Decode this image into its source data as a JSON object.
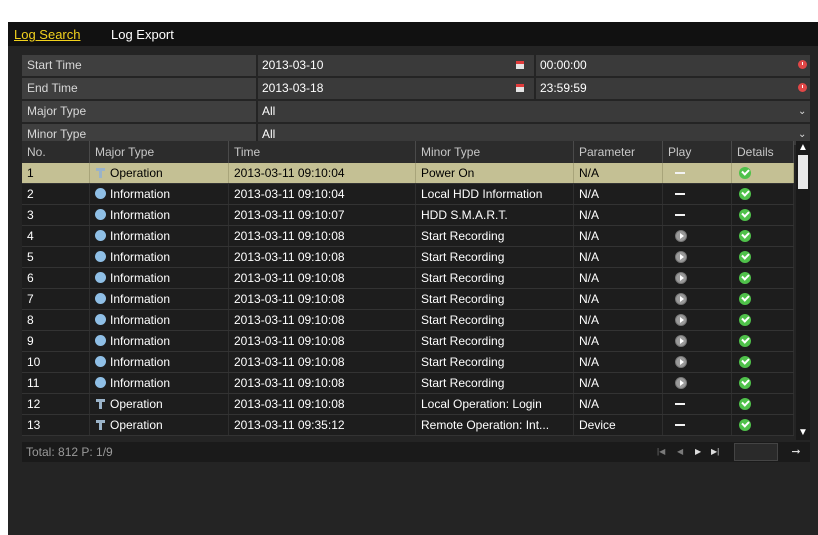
{
  "tabs": [
    {
      "label": "Log Search",
      "active": true
    },
    {
      "label": "Log Export",
      "active": false
    }
  ],
  "filters": {
    "start_label": "Start Time",
    "start_date": "2013-03-10",
    "start_time": "00:00:00",
    "end_label": "End Time",
    "end_date": "2013-03-18",
    "end_time": "23:59:59",
    "major_label": "Major Type",
    "major_value": "All",
    "minor_label": "Minor Type",
    "minor_value": "All"
  },
  "columns": [
    "No.",
    "Major Type",
    "Time",
    "Minor Type",
    "Parameter",
    "Play",
    "Details"
  ],
  "rows": [
    {
      "no": "1",
      "major": "Operation",
      "major_icon": "operation-icon",
      "time": "2013-03-11 09:10:04",
      "minor": "Power On",
      "param": "N/A",
      "play": "dash",
      "selected": true
    },
    {
      "no": "2",
      "major": "Information",
      "major_icon": "information-icon",
      "time": "2013-03-11 09:10:04",
      "minor": "Local HDD Information",
      "param": "N/A",
      "play": "dash",
      "selected": false
    },
    {
      "no": "3",
      "major": "Information",
      "major_icon": "information-icon",
      "time": "2013-03-11 09:10:07",
      "minor": "HDD S.M.A.R.T.",
      "param": "N/A",
      "play": "dash",
      "selected": false
    },
    {
      "no": "4",
      "major": "Information",
      "major_icon": "information-icon",
      "time": "2013-03-11 09:10:08",
      "minor": "Start Recording",
      "param": "N/A",
      "play": "play",
      "selected": false
    },
    {
      "no": "5",
      "major": "Information",
      "major_icon": "information-icon",
      "time": "2013-03-11 09:10:08",
      "minor": "Start Recording",
      "param": "N/A",
      "play": "play",
      "selected": false
    },
    {
      "no": "6",
      "major": "Information",
      "major_icon": "information-icon",
      "time": "2013-03-11 09:10:08",
      "minor": "Start Recording",
      "param": "N/A",
      "play": "play",
      "selected": false
    },
    {
      "no": "7",
      "major": "Information",
      "major_icon": "information-icon",
      "time": "2013-03-11 09:10:08",
      "minor": "Start Recording",
      "param": "N/A",
      "play": "play",
      "selected": false
    },
    {
      "no": "8",
      "major": "Information",
      "major_icon": "information-icon",
      "time": "2013-03-11 09:10:08",
      "minor": "Start Recording",
      "param": "N/A",
      "play": "play",
      "selected": false
    },
    {
      "no": "9",
      "major": "Information",
      "major_icon": "information-icon",
      "time": "2013-03-11 09:10:08",
      "minor": "Start Recording",
      "param": "N/A",
      "play": "play",
      "selected": false
    },
    {
      "no": "10",
      "major": "Information",
      "major_icon": "information-icon",
      "time": "2013-03-11 09:10:08",
      "minor": "Start Recording",
      "param": "N/A",
      "play": "play",
      "selected": false
    },
    {
      "no": "11",
      "major": "Information",
      "major_icon": "information-icon",
      "time": "2013-03-11 09:10:08",
      "minor": "Start Recording",
      "param": "N/A",
      "play": "play",
      "selected": false
    },
    {
      "no": "12",
      "major": "Operation",
      "major_icon": "operation-icon",
      "time": "2013-03-11 09:10:08",
      "minor": "Local Operation: Login",
      "param": "N/A",
      "play": "dash",
      "selected": false
    },
    {
      "no": "13",
      "major": "Operation",
      "major_icon": "operation-icon",
      "time": "2013-03-11 09:35:12",
      "minor": "Remote Operation: Int...",
      "param": "Device",
      "play": "dash",
      "selected": false
    }
  ],
  "footer": {
    "total": "Total: 812  P: 1/9"
  },
  "colors": {
    "accent": "#f2d21d",
    "selected_row": "#c4c094",
    "check": "#4fc14a"
  }
}
